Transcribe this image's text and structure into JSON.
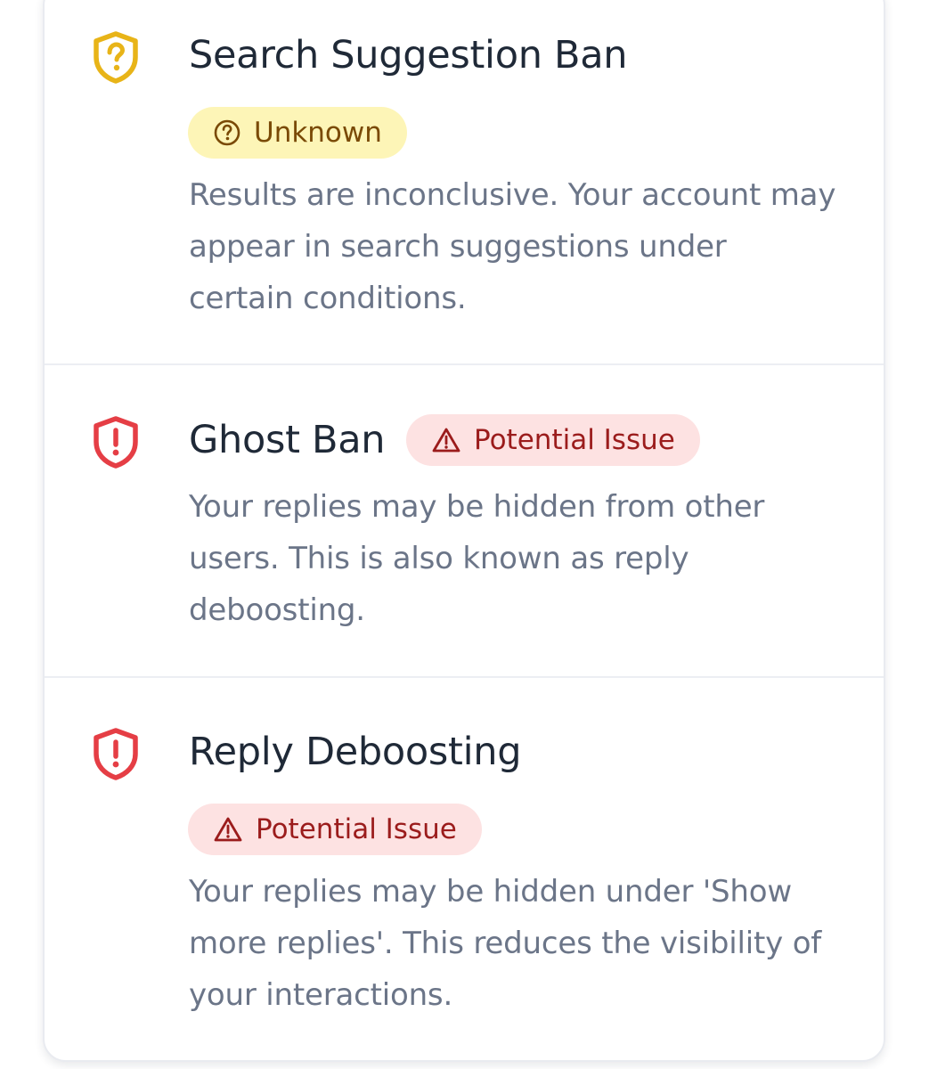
{
  "colors": {
    "warning": "#e8b418",
    "danger": "#e53e45",
    "title": "#1f2937",
    "description": "#6b7588"
  },
  "items": [
    {
      "title": "Search Suggestion Ban",
      "icon": "shield-question-icon",
      "status": {
        "label": "Unknown",
        "icon": "question-circle-icon"
      },
      "description": "Results are inconclusive. Your account may appear in search suggestions under certain conditions."
    },
    {
      "title": "Ghost Ban",
      "icon": "shield-alert-icon",
      "status": {
        "label": "Potential Issue",
        "icon": "warning-triangle-icon"
      },
      "description": "Your replies may be hidden from other users. This is also known as reply deboosting."
    },
    {
      "title": "Reply Deboosting",
      "icon": "shield-alert-icon",
      "status": {
        "label": "Potential Issue",
        "icon": "warning-triangle-icon"
      },
      "description": "Your replies may be hidden under 'Show more replies'. This reduces the visibility of your interactions."
    }
  ]
}
